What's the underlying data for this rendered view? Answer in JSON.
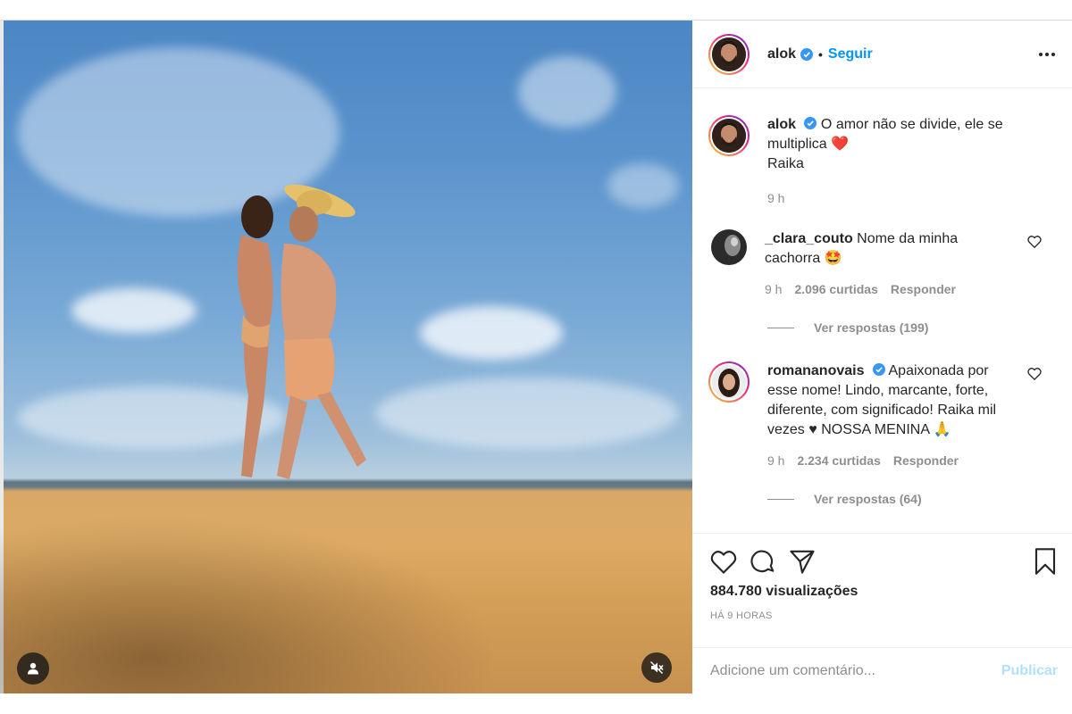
{
  "header": {
    "username": "alok",
    "separator": "•",
    "follow_label": "Seguir"
  },
  "caption": {
    "username": "alok",
    "text": "O amor não se divide, ele se multiplica",
    "emoji": "❤️",
    "second_line": "Raika",
    "time": "9 h"
  },
  "comments": [
    {
      "username": "_clara_couto",
      "text": "Nome da minha cachorra",
      "emoji": "🤩",
      "time": "9 h",
      "likes": "2.096 curtidas",
      "reply_label": "Responder",
      "view_replies": "Ver respostas (199)"
    },
    {
      "username": "romananovais",
      "text": "Apaixonada por esse nome! Lindo, marcante, forte, diferente, com significado! Raika mil vezes ♥ NOSSA MENINA",
      "emoji": "🙏",
      "time": "9 h",
      "likes": "2.234 curtidas",
      "reply_label": "Responder",
      "view_replies": "Ver respostas (64)"
    }
  ],
  "stats": {
    "views": "884.780 visualizações",
    "time_ago": "HÁ 9 HORAS"
  },
  "composer": {
    "placeholder": "Adicione um comentário...",
    "publish_label": "Publicar"
  },
  "icons": {
    "verified": "verified-badge-icon",
    "more": "more-options-icon",
    "like": "heart-icon",
    "comment": "comment-bubble-icon",
    "share": "paper-plane-icon",
    "save": "bookmark-icon",
    "user_tag": "user-tag-icon",
    "mute": "speaker-muted-icon"
  },
  "colors": {
    "link_blue": "#0095f6",
    "verified_blue": "#3897f0",
    "muted_text": "#8e8e8e",
    "publish_disabled": "#b2dffc"
  }
}
